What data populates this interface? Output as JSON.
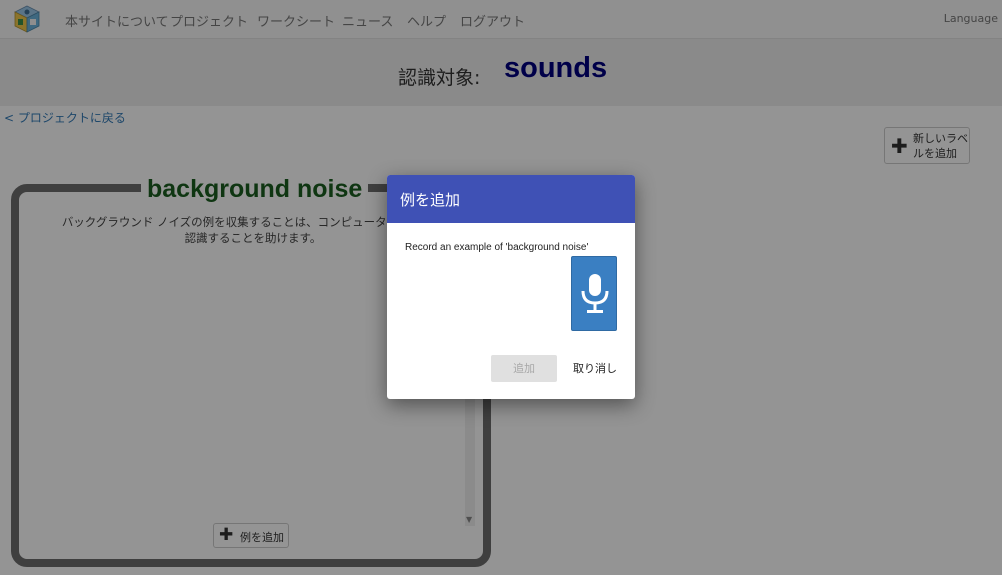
{
  "nav": {
    "logo_icon": "ml4k-cube-logo",
    "items": [
      "本サイトについて",
      "プロジェクト",
      "ワークシート",
      "ニュース",
      "ヘルプ",
      "ログアウト"
    ],
    "language": "Language"
  },
  "header": {
    "label": "認識対象:",
    "project_name": "sounds"
  },
  "back_link": "< プロジェクトに戻る",
  "new_label_button": {
    "icon": "plus-icon",
    "label": "新しいラベルを追加"
  },
  "label_card": {
    "title": "background noise",
    "description": "バックグラウンド ノイズの例を収集することは、コンピュータがあなたの",
    "description_line2": "認識することを助けます。",
    "add_example_button": {
      "icon": "plus-icon",
      "label": "例を追加"
    }
  },
  "dialog": {
    "title": "例を追加",
    "prompt": "Record an example of 'background noise'",
    "mic_icon": "microphone-icon",
    "add_button": "追加",
    "cancel_button": "取り消し"
  },
  "colors": {
    "project_name": "#00007f",
    "card_title": "#1b5e20",
    "dialog_header": "#3f51b5",
    "mic_button": "#3a7fc2",
    "link": "#337ab7"
  }
}
